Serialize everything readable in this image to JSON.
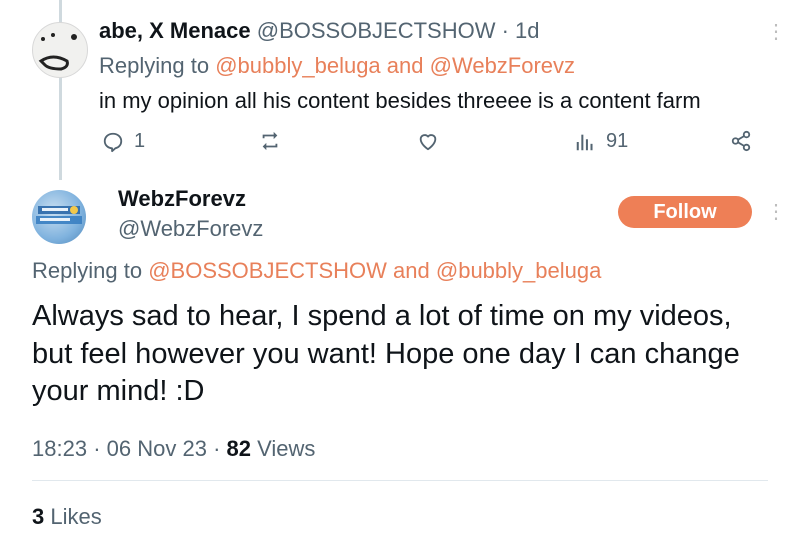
{
  "tweet1": {
    "name": "abe, X Menace",
    "handle": "@BOSSOBJECTSHOW",
    "separator": "·",
    "time": "1d",
    "replying_prefix": "Replying to",
    "reply_to_1": "@bubbly_beluga",
    "reply_and": "and",
    "reply_to_2": "@WebzForevz",
    "text": "in my opinion all his content besides threeee is a content farm",
    "stats": {
      "replies": "1",
      "views": "91"
    }
  },
  "tweet2": {
    "name": "WebzForevz",
    "handle": "@WebzForevz",
    "follow_label": "Follow",
    "replying_prefix": "Replying to",
    "reply_to_1": "@BOSSOBJECTSHOW",
    "reply_and": "and",
    "reply_to_2": "@bubbly_beluga",
    "text": "Always sad to hear, I spend a lot of time on my videos, but feel however you want! Hope one day I can change your mind! :D",
    "time": "18:23",
    "separator": "·",
    "date": "06 Nov 23",
    "separator2": "·",
    "views_count": "82",
    "views_label": "Views",
    "likes_count": "3",
    "likes_label": "Likes"
  },
  "icons": {
    "reply": "reply-icon",
    "retweet": "retweet-icon",
    "like": "heart-icon",
    "views": "views-icon",
    "share": "share-icon",
    "more": "more-vertical-icon"
  },
  "colors": {
    "accent": "#ee7f56",
    "mention": "#e8805a",
    "secondary_text": "#536471",
    "primary_text": "#0f1419"
  }
}
